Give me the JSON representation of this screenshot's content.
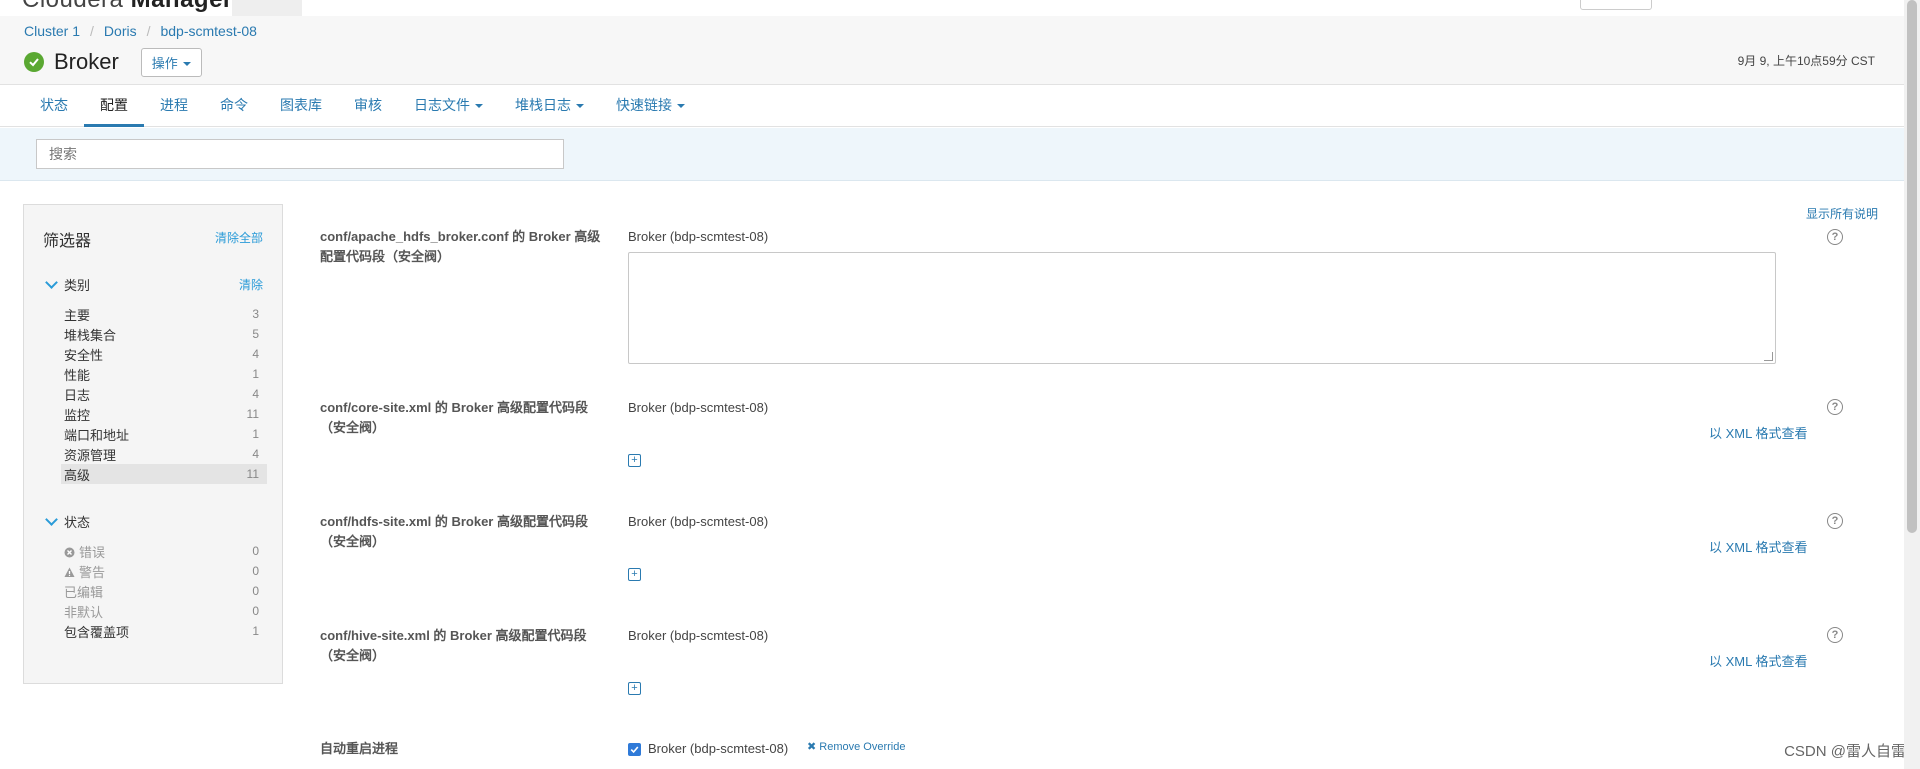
{
  "app": {
    "brand_prefix": "Cloudera",
    "brand_name": "Manager"
  },
  "breadcrumb": [
    "Cluster 1",
    "Doris",
    "bdp-scmtest-08"
  ],
  "page": {
    "title": "Broker",
    "actions_label": "操作",
    "timestamp": "9月 9, 上午10点59分 CST"
  },
  "tabs": [
    {
      "label": "状态"
    },
    {
      "label": "配置"
    },
    {
      "label": "进程"
    },
    {
      "label": "命令"
    },
    {
      "label": "图表库"
    },
    {
      "label": "审核"
    },
    {
      "label": "日志文件"
    },
    {
      "label": "堆栈日志"
    },
    {
      "label": "快速链接"
    }
  ],
  "search": {
    "placeholder": "搜索",
    "value": ""
  },
  "filters": {
    "title": "筛选器",
    "clear_all": "清除全部",
    "category": {
      "label": "类别",
      "clear": "清除",
      "items": [
        {
          "label": "主要",
          "count": "3"
        },
        {
          "label": "堆栈集合",
          "count": "5"
        },
        {
          "label": "安全性",
          "count": "4"
        },
        {
          "label": "性能",
          "count": "1"
        },
        {
          "label": "日志",
          "count": "4"
        },
        {
          "label": "监控",
          "count": "11"
        },
        {
          "label": "端口和地址",
          "count": "1"
        },
        {
          "label": "资源管理",
          "count": "4"
        },
        {
          "label": "高级",
          "count": "11"
        }
      ]
    },
    "status": {
      "label": "状态",
      "items": [
        {
          "label": "错误",
          "count": "0",
          "icon": "error-icon"
        },
        {
          "label": "警告",
          "count": "0",
          "icon": "warning-icon"
        },
        {
          "label": "已编辑",
          "count": "0"
        },
        {
          "label": "非默认",
          "count": "0"
        },
        {
          "label": "包含覆盖项",
          "count": "1"
        }
      ]
    }
  },
  "show_all_desc": "显示所有说明",
  "properties": [
    {
      "label": "conf/apache_hdfs_broker.conf 的 Broker 高级配置代码段（安全阀）",
      "scope": "Broker (bdp-scmtest-08)"
    },
    {
      "label": "conf/core-site.xml 的 Broker 高级配置代码段（安全阀）",
      "scope": "Broker (bdp-scmtest-08)",
      "xml_link": "以 XML 格式查看"
    },
    {
      "label": "conf/hdfs-site.xml 的 Broker 高级配置代码段（安全阀）",
      "scope": "Broker (bdp-scmtest-08)",
      "xml_link": "以 XML 格式查看"
    },
    {
      "label": "conf/hive-site.xml 的 Broker 高级配置代码段（安全阀）",
      "scope": "Broker (bdp-scmtest-08)",
      "xml_link": "以 XML 格式查看"
    },
    {
      "label": "自动重启进程",
      "scope": "Broker (bdp-scmtest-08)",
      "override_label": "Remove Override",
      "checked": true
    }
  ],
  "watermark": "CSDN @雷人自雷",
  "colors": {
    "accent": "#2a7ab0",
    "ok": "#5aa832",
    "checkbox": "#2f7ad8"
  }
}
